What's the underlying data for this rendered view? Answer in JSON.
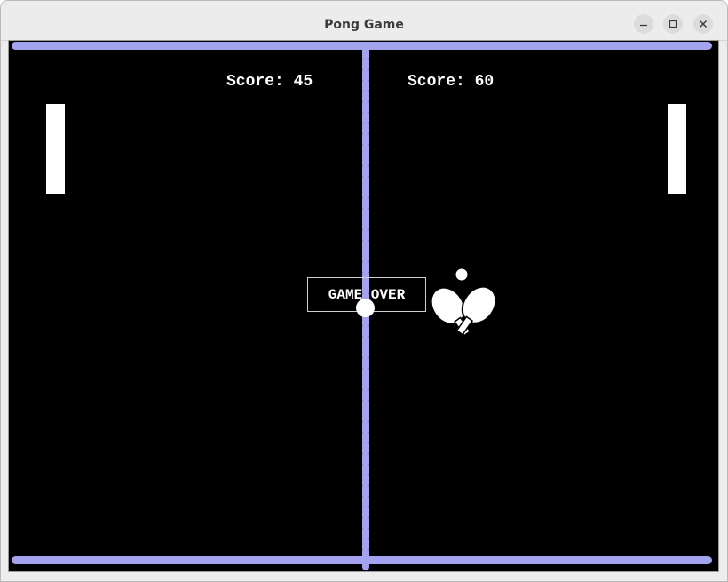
{
  "window": {
    "title": "Pong Game",
    "controls": [
      "minimize",
      "maximize",
      "close"
    ]
  },
  "game": {
    "score_left": "Score: 45",
    "score_right": "Score: 60",
    "status_message": "GAME OVER",
    "icon": "ping-pong-paddles-icon",
    "colors": {
      "background": "#000000",
      "walls_and_net": "#a3a3ef",
      "paddles_and_ball": "#ffffff"
    }
  }
}
